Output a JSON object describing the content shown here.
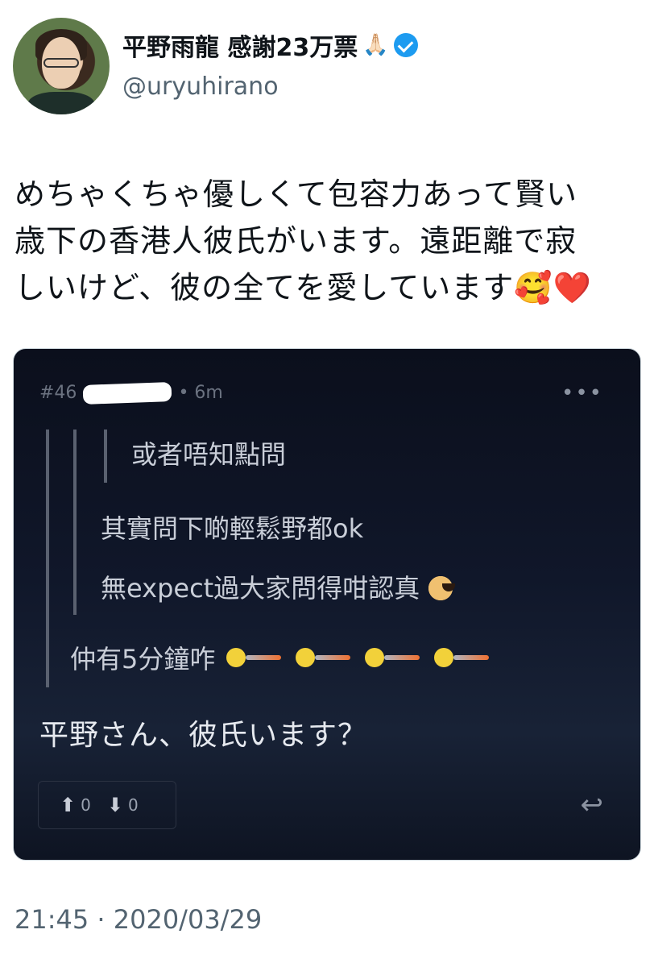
{
  "profile": {
    "display_name": "平野雨龍 感謝23万票",
    "name_emoji": "🙏🏻",
    "verified_icon": "verified-badge-icon",
    "handle": "@uryuhirano"
  },
  "tweet": {
    "line1": "めちゃくちゃ優しくて包容力あって賢い",
    "line2": "歳下の香港人彼氏がいます。遠距離で寂",
    "line3": "しいけど、彼の全てを愛しています🥰❤️"
  },
  "embedded_post": {
    "post_number": "#46",
    "age": "• 6m",
    "more_icon": "•••",
    "quote_level3": "或者唔知點問",
    "quote_level2_line1": "其實問下啲輕鬆野都ok",
    "quote_level2_line2": "無expect過大家問得咁認真",
    "quote_level1": "仲有5分鐘咋",
    "reply": "平野さん、彼氏います？",
    "upvote_count": "0",
    "downvote_count": "0",
    "upvote_icon": "⬆",
    "downvote_icon": "⬇",
    "reply_icon": "↩"
  },
  "timestamp": "21:45 · 2020/03/29",
  "colors": {
    "verified": "#1d9bf0",
    "media_bg": "#10172a",
    "handle": "#536471"
  }
}
